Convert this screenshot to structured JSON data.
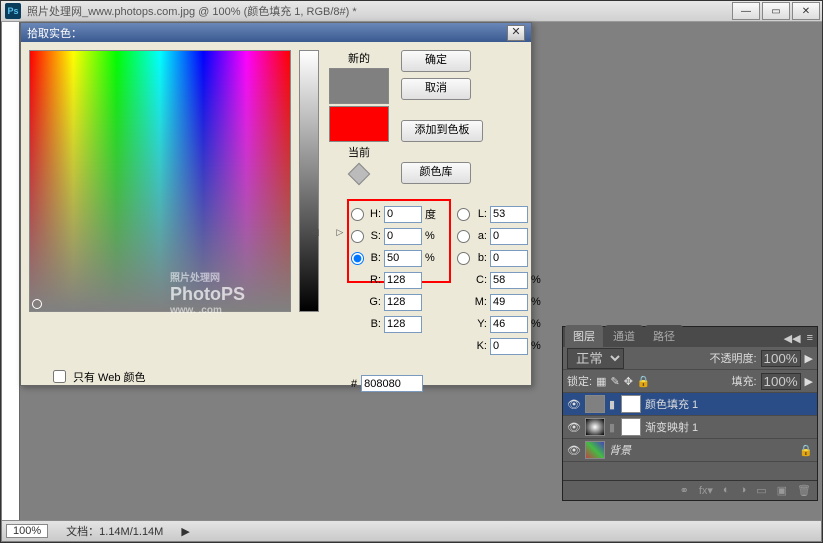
{
  "titlebar": {
    "ps": "Ps",
    "title": "照片处理网_www.photops.com.jpg @ 100% (颜色填充 1, RGB/8#) *"
  },
  "dialog": {
    "title": "拾取实色：",
    "new_label": "新的",
    "current_label": "当前",
    "btn_ok": "确定",
    "btn_cancel": "取消",
    "btn_add": "添加到色板",
    "btn_lib": "颜色库",
    "swatch_new": "#808080",
    "swatch_cur": "#ff0000",
    "fields": {
      "H": {
        "v": "0",
        "u": "度"
      },
      "S": {
        "v": "0",
        "u": "%"
      },
      "B": {
        "v": "50",
        "u": "%"
      },
      "L": {
        "v": "53",
        "u": ""
      },
      "a": {
        "v": "0",
        "u": ""
      },
      "b": {
        "v": "0",
        "u": ""
      },
      "R": {
        "v": "128",
        "u": ""
      },
      "G": {
        "v": "128",
        "u": ""
      },
      "Bc": {
        "v": "128",
        "u": ""
      },
      "C": {
        "v": "58",
        "u": "%"
      },
      "M": {
        "v": "49",
        "u": "%"
      },
      "Y": {
        "v": "46",
        "u": "%"
      },
      "K": {
        "v": "0",
        "u": "%"
      }
    },
    "hex": "808080",
    "webonly": "只有 Web 颜色"
  },
  "wm": {
    "t1": "照片处理网",
    "t2": "PhotoPS",
    "t3": "www.                    .com"
  },
  "layers": {
    "tab1": "图层",
    "tab2": "通道",
    "tab3": "路径",
    "mode": "正常",
    "opacity_lbl": "不透明度:",
    "opacity": "100%",
    "lock_lbl": "锁定:",
    "fill_lbl": "填充:",
    "fill": "100%",
    "items": [
      {
        "name": "颜色填充 1"
      },
      {
        "name": "渐变映射 1"
      },
      {
        "name": "背景"
      }
    ]
  },
  "status": {
    "zoom": "100%",
    "doc": "文档：1.14M/1.14M"
  }
}
